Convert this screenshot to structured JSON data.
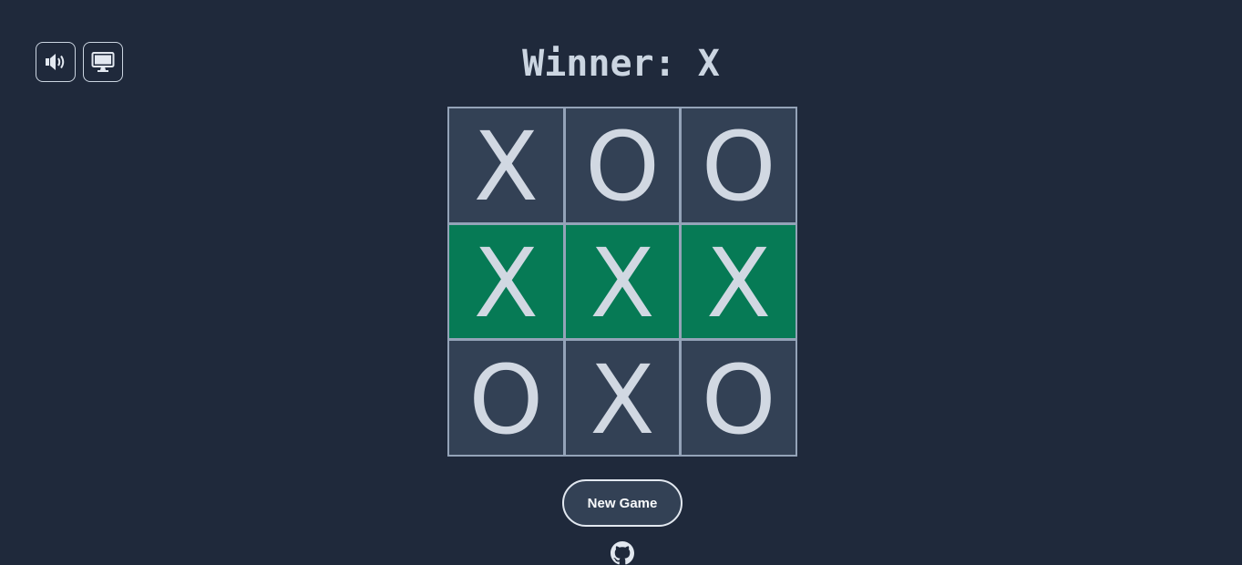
{
  "status": {
    "text": "Winner: X"
  },
  "controls": {
    "sound_icon": "speaker-icon",
    "mode_icon": "computer-monitor-icon"
  },
  "board": {
    "cells": [
      "X",
      "O",
      "O",
      "X",
      "X",
      "X",
      "O",
      "X",
      "O"
    ],
    "winning_cells": [
      3,
      4,
      5
    ],
    "colors": {
      "cell": "#334155",
      "winning_cell": "#067a55",
      "grid_line": "#94a3b8",
      "mark": "#d1d8e2"
    }
  },
  "actions": {
    "new_game_label": "New Game"
  },
  "footer": {
    "link_icon": "github-icon"
  },
  "theme": {
    "background": "#1f293b",
    "text": "#cbd5e1"
  }
}
